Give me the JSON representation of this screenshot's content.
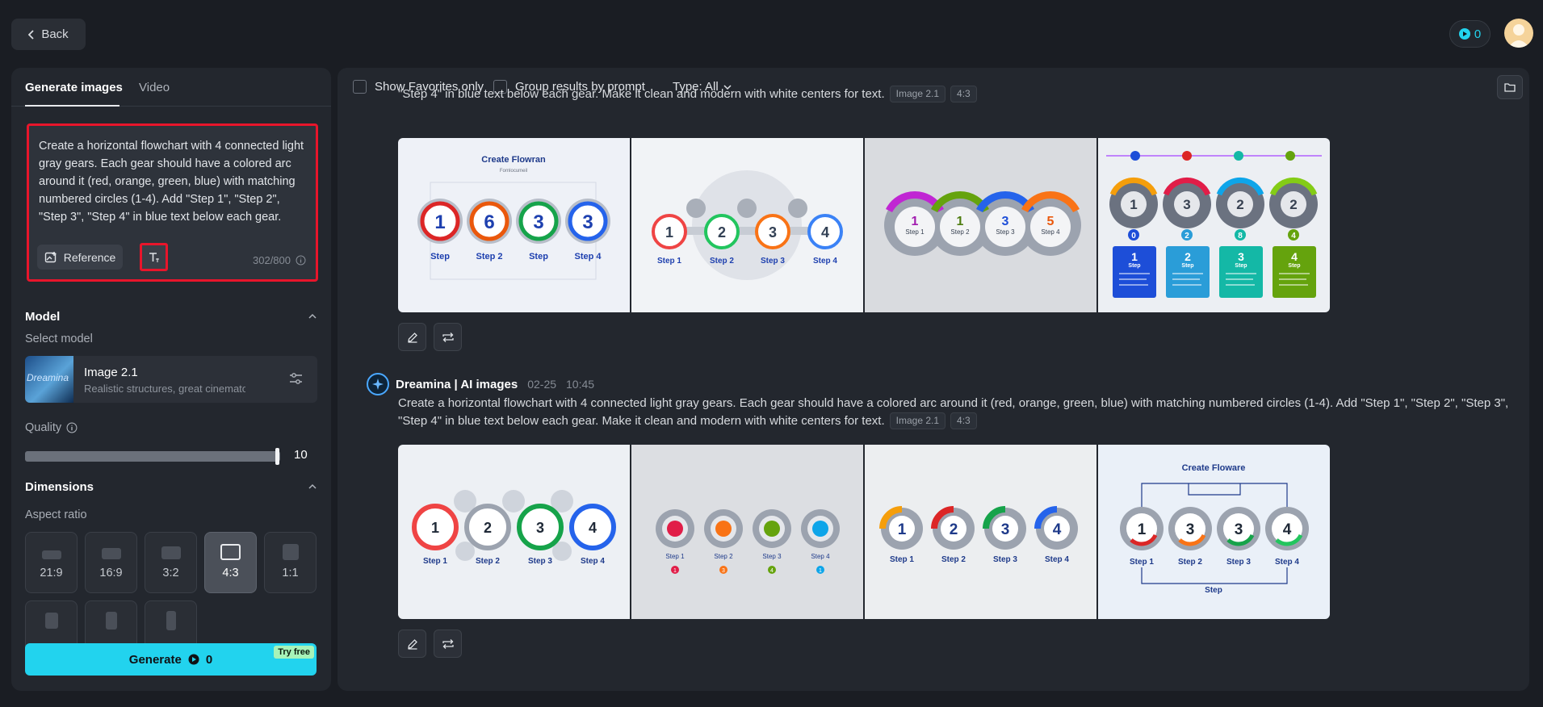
{
  "topbar": {
    "back_label": "Back",
    "credits": "0"
  },
  "left_panel": {
    "tabs": [
      {
        "label": "Generate images"
      },
      {
        "label": "Video"
      }
    ],
    "prompt": {
      "text": "Create a horizontal flowchart with 4 connected light gray gears. Each gear should have a colored arc around it (red, orange, green, blue) with matching numbered circles (1-4). Add \"Step 1\", \"Step 2\", \"Step 3\", \"Step 4\" in blue text below each gear. Make it clean and modern with white centers for text.",
      "reference_label": "Reference",
      "char_count": "302/800"
    },
    "model": {
      "section_title": "Model",
      "select_label": "Select model",
      "name": "Image 2.1",
      "description": "Realistic structures, great cinematog...",
      "thumb_text": "Dreamina"
    },
    "quality": {
      "label": "Quality",
      "value": 10,
      "display": "10",
      "fraction": 1.0
    },
    "dimensions": {
      "section_title": "Dimensions",
      "aspect_label": "Aspect ratio",
      "selected": "4:3",
      "ratios": [
        {
          "label": "21:9"
        },
        {
          "label": "16:9"
        },
        {
          "label": "3:2"
        },
        {
          "label": "4:3"
        },
        {
          "label": "1:1"
        },
        {
          "label": ""
        },
        {
          "label": ""
        },
        {
          "label": ""
        }
      ]
    },
    "generate": {
      "label": "Generate",
      "cost": "0",
      "badge": "Try free"
    }
  },
  "results": {
    "filters": {
      "favorites_label": "Show Favorites only",
      "group_label": "Group results by prompt",
      "type_label": "Type: All"
    },
    "groups": [
      {
        "prompt_tail": "\"Step 4\" in blue text below each gear. Make it clean and modern with white centers for text.",
        "model_chip": "Image 2.1",
        "ratio_chip": "4:3",
        "images": [
          {
            "title": "Create Flowran",
            "subtitle": "Fornlocumeil",
            "numbers": [
              "1",
              "6",
              "3",
              "3"
            ],
            "labels": [
              "Step",
              "Step 2",
              "Step",
              "Step 4"
            ]
          },
          {
            "numbers": [
              "1",
              "2",
              "3",
              "4"
            ],
            "labels": [
              "Step 1",
              "Step 2",
              "Step 3",
              "Step 4"
            ]
          },
          {
            "numbers": [
              "1",
              "1",
              "3",
              "5"
            ],
            "labels": [
              "Step 1",
              "Step 2",
              "Step 3",
              "Step 4"
            ]
          },
          {
            "numbers": [
              "1",
              "3",
              "2",
              "2"
            ],
            "badges": [
              "0",
              "2",
              "8",
              "4"
            ],
            "cards": [
              "1",
              "2",
              "3",
              "4"
            ],
            "card_words": [
              "Step",
              "Step",
              "Step",
              "Step"
            ]
          }
        ]
      },
      {
        "author": "Dreamina | AI images",
        "date": "02-25",
        "time": "10:45",
        "prompt": "Create a horizontal flowchart with 4 connected light gray gears. Each gear should have a colored arc around it (red, orange, green, blue) with matching numbered circles (1-4). Add \"Step 1\", \"Step 2\", \"Step 3\", \"Step 4\" in blue text below each gear. Make it clean and modern with white centers for text.",
        "model_chip": "Image 2.1",
        "ratio_chip": "4:3",
        "images": [
          {
            "numbers": [
              "1",
              "2",
              "3",
              "4"
            ],
            "labels": [
              "Step 1",
              "Step 2",
              "Step 3",
              "Step 4"
            ]
          },
          {
            "labels": [
              "Step 1",
              "Step 2",
              "Step 3",
              "Step 4"
            ],
            "dots": [
              "1",
              "3",
              "4",
              "1"
            ]
          },
          {
            "numbers": [
              "1",
              "2",
              "3",
              "4"
            ],
            "labels": [
              "Step 1",
              "Step 2",
              "Step 3",
              "Step 4"
            ]
          },
          {
            "title": "Create Flowarе",
            "numbers": [
              "1",
              "3",
              "3",
              "4"
            ],
            "labels": [
              "Step 1",
              "Step 2",
              "Step 3",
              "Step 4"
            ],
            "footer": "Step"
          }
        ]
      }
    ]
  },
  "colors": {
    "accent": "#22d3ee",
    "highlight": "#e8152b",
    "step_blue": "#1e40af"
  }
}
